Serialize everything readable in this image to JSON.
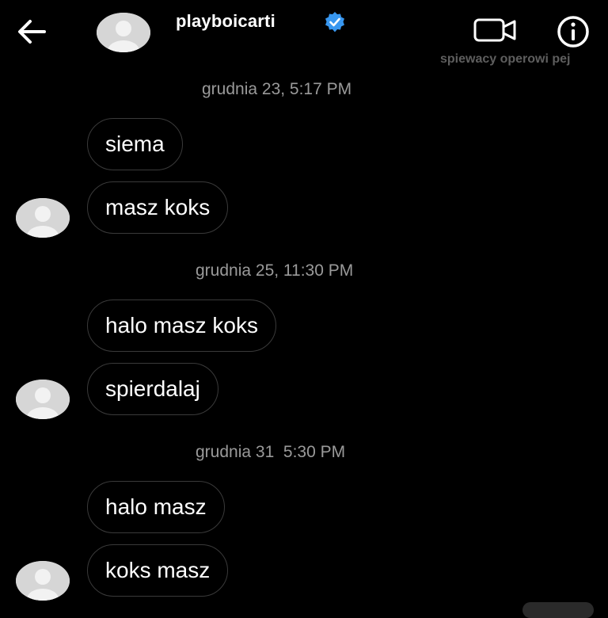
{
  "header": {
    "username": "playboicarti",
    "subtitle": "spiewacy operowi pej",
    "icons": {
      "back": "arrow-left-icon",
      "verified": "verified-badge-icon",
      "video": "video-camera-icon",
      "info": "info-icon"
    },
    "verified_color": "#3897f0"
  },
  "timestamps": [
    "grudnia 23, 5:17 PM",
    "grudnia 25, 11:30 PM",
    "grudnia 31  5:30 PM"
  ],
  "messages": [
    {
      "text": "siema",
      "avatar": false
    },
    {
      "text": "masz koks",
      "avatar": true
    },
    {
      "text": "halo masz koks",
      "avatar": false
    },
    {
      "text": "spierdalaj",
      "avatar": true
    },
    {
      "text": "halo masz",
      "avatar": false
    },
    {
      "text": "koks masz",
      "avatar": true
    }
  ]
}
